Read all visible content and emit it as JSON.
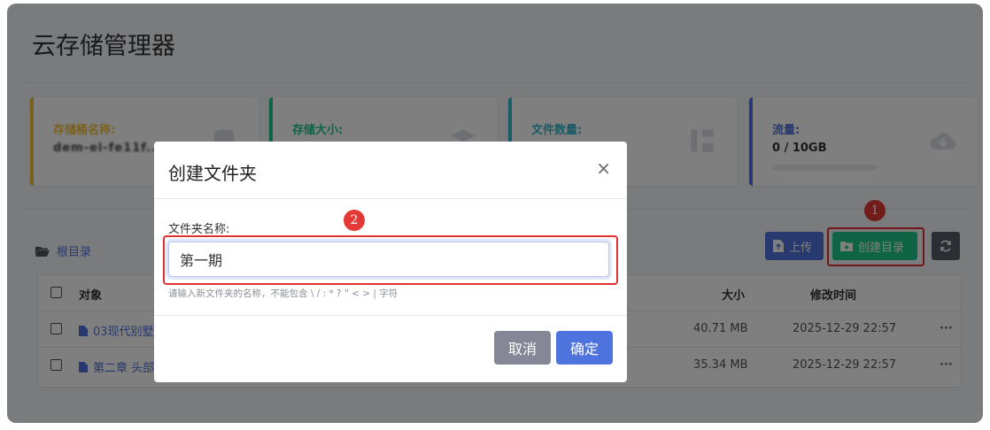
{
  "app": {
    "title": "云存储管理器"
  },
  "colors": {
    "primary": "#4e73df",
    "success": "#1cc88a",
    "warning": "#f6c23e",
    "info": "#36b9cc",
    "secondary": "#858796",
    "annotation": "#e53935"
  },
  "stats": [
    {
      "label": "存储桶名称:",
      "value": "dem-el-fe11f...",
      "icon": "database-icon",
      "accent": "#f6c23e"
    },
    {
      "label": "存储大小:",
      "value": "",
      "icon": "layers-icon",
      "accent": "#1cc88a"
    },
    {
      "label": "文件数量:",
      "value": "",
      "icon": "sitemap-icon",
      "accent": "#36b9cc"
    },
    {
      "label": "流量:",
      "value": "0 / 10GB",
      "icon": "cloud-download-icon",
      "accent": "#4e73df",
      "progress": 0
    }
  ],
  "breadcrumb": {
    "label": "根目录",
    "icon": "folder-open-icon"
  },
  "toolbar": {
    "upload_label": "上传",
    "mkdir_label": "创建目录",
    "refresh_icon": "refresh-icon"
  },
  "table": {
    "headers": {
      "name": "对象",
      "size": "大小",
      "modified": "修改时间"
    },
    "rows": [
      {
        "name": "03现代别墅",
        "size": "40.71 MB",
        "modified": "2025-12-29 22:57",
        "more": "···"
      },
      {
        "name": "第二章 头部",
        "size": "35.34 MB",
        "modified": "2025-12-29 22:57",
        "more": "···"
      }
    ]
  },
  "annotations": {
    "step1": "1",
    "step2": "2"
  },
  "modal": {
    "title": "创建文件夹",
    "close": "×",
    "field_label": "文件夹名称:",
    "field_value": "第一期",
    "hint": "请输入新文件夹的名称，不能包含 \\ / : * ? \" < > | 字符",
    "cancel_label": "取消",
    "ok_label": "确定"
  }
}
